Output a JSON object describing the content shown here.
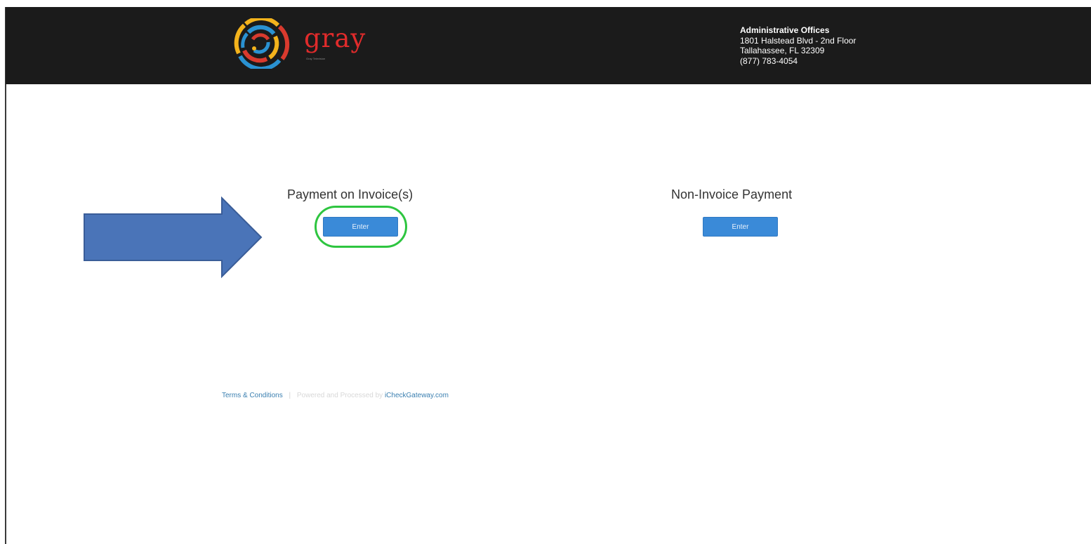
{
  "header": {
    "logo": {
      "wordmark": "gray",
      "tagline": "Gray Television",
      "icon": "gray-logo-icon"
    },
    "address": {
      "title": "Administrative Offices",
      "line1": "1801 Halstead Blvd - 2nd Floor",
      "line2": "Tallahassee, FL 32309",
      "phone": "(877) 783-4054"
    }
  },
  "options": [
    {
      "title": "Payment on Invoice(s)",
      "button_label": "Enter"
    },
    {
      "title": "Non-Invoice Payment",
      "button_label": "Enter"
    }
  ],
  "annotation": {
    "arrow_color": "#4a74b8",
    "highlight_color": "#2ec540"
  },
  "footer": {
    "terms_label": "Terms & Conditions",
    "powered_text": "Powered and Processed by",
    "gateway_label": "iCheckGateway.com"
  },
  "colors": {
    "header_bg": "#1b1b1b",
    "button_bg": "#3a8ad8",
    "brand_red": "#e02b2b"
  }
}
